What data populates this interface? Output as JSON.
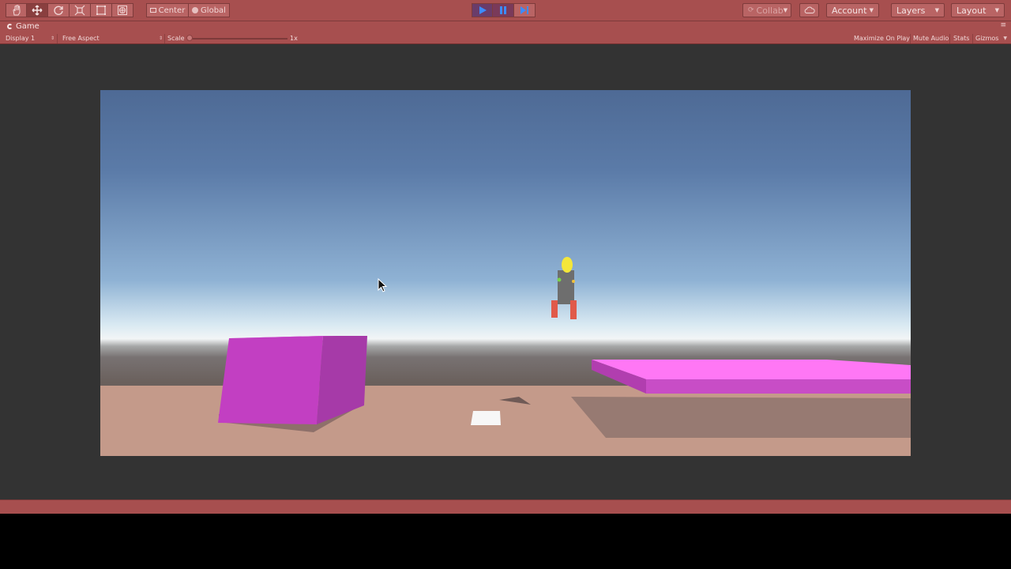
{
  "toolbar": {
    "pivot_label": "Center",
    "space_label": "Global",
    "collab_label": "Collab",
    "account_label": "Account",
    "layers_label": "Layers",
    "layout_label": "Layout"
  },
  "game_tab": {
    "title": "Game",
    "display": "Display 1",
    "aspect": "Free Aspect",
    "scale_label": "Scale",
    "scale_value": "1x",
    "maximize_on_play": "Maximize On Play",
    "mute_audio": "Mute Audio",
    "stats": "Stats",
    "gizmos": "Gizmos"
  },
  "play_state": {
    "playing": true,
    "paused": true
  },
  "colors": {
    "editor_tint": "#a74f4f",
    "workspace": "#333333",
    "magenta_box": "#c23fc2",
    "magenta_platform": "#ff77f5",
    "ground": "#c49a8a",
    "rocket_nose": "#f4e73a",
    "rocket_body": "#6e6e6e",
    "rocket_legs": "#e05a4a"
  },
  "icons": {
    "hand": "hand-icon",
    "move": "move-icon",
    "rotate": "rotate-icon",
    "scale": "scale-icon",
    "rect": "rect-tool-icon",
    "transform": "transform-icon",
    "play": "play-icon",
    "pause": "pause-icon",
    "step": "step-icon",
    "cloud": "cloud-icon",
    "cursor": "mouse-cursor-icon"
  }
}
